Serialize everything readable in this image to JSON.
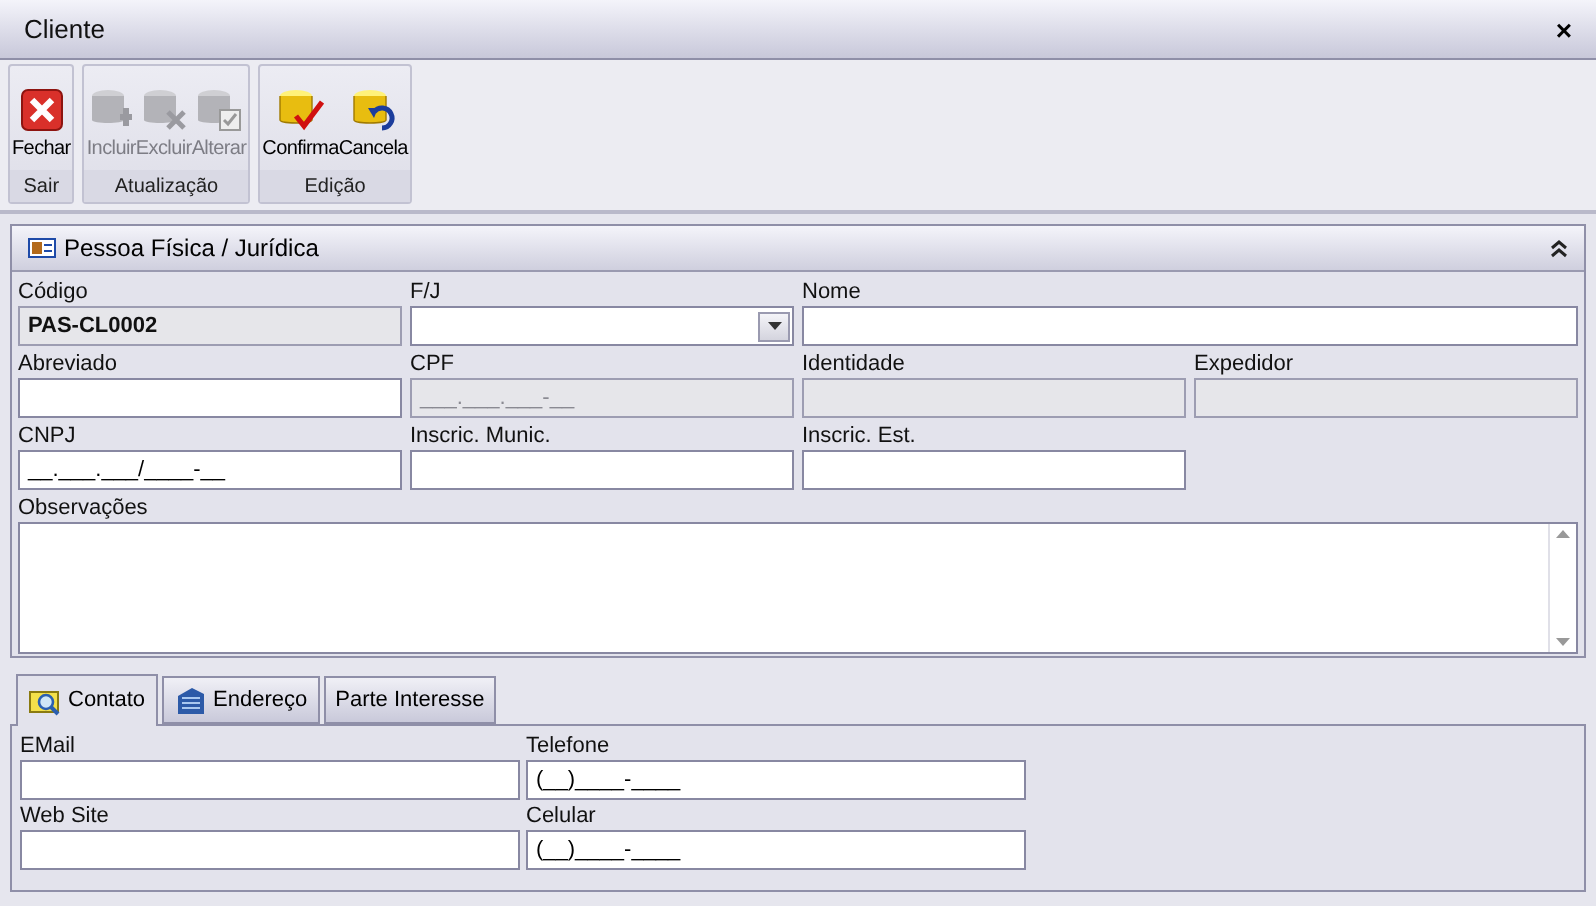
{
  "window": {
    "title": "Cliente",
    "close": "×"
  },
  "toolbar": {
    "groups": [
      {
        "label": "Sair",
        "buttons": [
          {
            "label": "Fechar",
            "kind": "close",
            "disabled": false
          }
        ]
      },
      {
        "label": "Atualização",
        "buttons": [
          {
            "label": "Incluir",
            "kind": "add",
            "disabled": true
          },
          {
            "label": "Excluir",
            "kind": "delete",
            "disabled": true
          },
          {
            "label": "Alterar",
            "kind": "edit",
            "disabled": true
          }
        ]
      },
      {
        "label": "Edição",
        "buttons": [
          {
            "label": "Confirma",
            "kind": "confirm",
            "disabled": false
          },
          {
            "label": "Cancela",
            "kind": "undo",
            "disabled": false
          }
        ]
      }
    ]
  },
  "panel": {
    "title": "Pessoa Física / Jurídica",
    "expanded": true,
    "rows": [
      [
        {
          "label": "Código",
          "kind": "text",
          "value": "PAS-CL0002",
          "disabled": true
        },
        {
          "label": "F/J",
          "kind": "select",
          "disabled": false
        },
        {
          "label": "Nome",
          "kind": "text",
          "disabled": false
        }
      ],
      [
        {
          "label": "Abreviado",
          "kind": "text",
          "disabled": false
        },
        {
          "label": "CPF",
          "kind": "text",
          "value": "___.___.___-__",
          "disabled": true
        },
        {
          "label": "Identidade",
          "kind": "text",
          "disabled": true
        },
        {
          "label": "Expedidor",
          "kind": "text",
          "disabled": true
        }
      ],
      [
        {
          "label": "CNPJ",
          "kind": "text",
          "value": "__.___.___/____-__",
          "disabled": false
        },
        {
          "label": "Inscric. Munic.",
          "kind": "text",
          "disabled": false
        },
        {
          "label": "Inscric. Est.",
          "kind": "text",
          "disabled": false
        }
      ],
      [
        {
          "label": "Observações",
          "kind": "textarea",
          "disabled": false
        }
      ]
    ]
  },
  "tabs": [
    {
      "label": "Contato",
      "kind": "contact",
      "selected": true
    },
    {
      "label": "Endereço",
      "kind": "building",
      "selected": false
    },
    {
      "label": "Parte Interesse",
      "kind": "none",
      "selected": false
    }
  ],
  "tab_fields": [
    {
      "label": "EMail"
    },
    {
      "label": "Telefone",
      "value": "(__)____-____"
    },
    {
      "label": "Web Site"
    },
    {
      "label": "Celular",
      "value": "(__)____-____"
    }
  ]
}
